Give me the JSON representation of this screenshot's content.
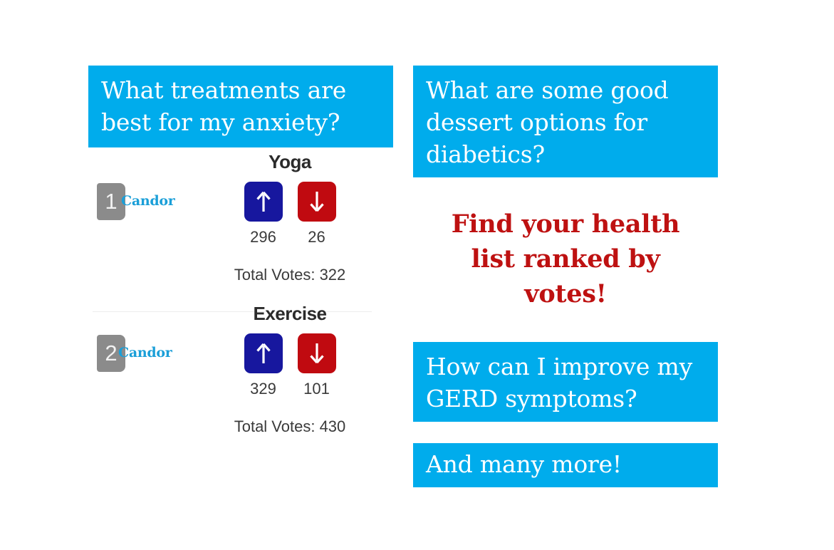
{
  "brand": {
    "name": "Candor",
    "accent_blue": "#00ACEC",
    "logo_blue": "#1B9FD8",
    "upvote_color": "#17179E",
    "downvote_color": "#C00A10",
    "cta_red": "#BE1111",
    "badge_gray": "#8b8b8b"
  },
  "left_column": {
    "question_banner": "What treatments are best for my anxiety?",
    "items": [
      {
        "rank": "1",
        "brand_label": "Candor",
        "title": "Yoga",
        "upvote_icon": "arrow-up-icon",
        "downvote_icon": "arrow-down-icon",
        "upvotes": "296",
        "downvotes": "26",
        "total_votes": "Total Votes: 322"
      },
      {
        "rank": "2",
        "brand_label": "Candor",
        "title": "Exercise",
        "upvote_icon": "arrow-up-icon",
        "downvote_icon": "arrow-down-icon",
        "upvotes": "329",
        "downvotes": "101",
        "total_votes": "Total Votes: 430"
      }
    ]
  },
  "right_column": {
    "banner_dessert": "What are some good dessert options for diabetics?",
    "cta_line1": "Find your health",
    "cta_line2": "list ranked by",
    "cta_line3": "votes!",
    "banner_gerd": "How can I improve my GERD symptoms?",
    "banner_more": "And many more!"
  }
}
